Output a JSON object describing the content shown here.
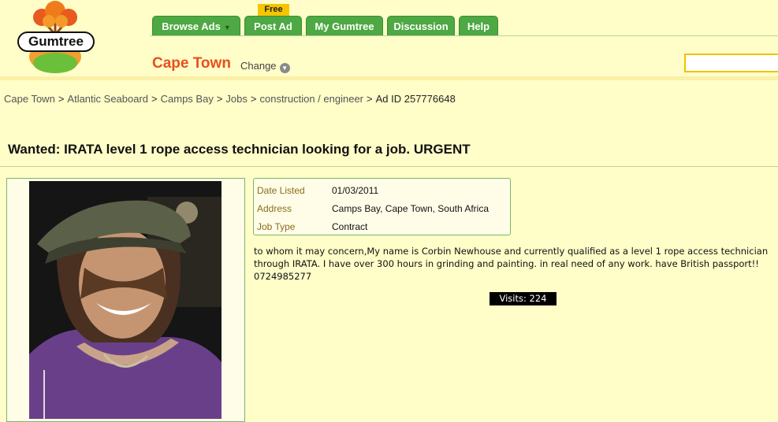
{
  "brand": {
    "name": "Gumtree"
  },
  "nav": {
    "tabs": [
      {
        "label": "Browse Ads"
      },
      {
        "label": "Post Ad"
      },
      {
        "label": "My Gumtree"
      },
      {
        "label": "Discussion"
      },
      {
        "label": "Help"
      }
    ],
    "free_badge": "Free",
    "accent": "#4ea843"
  },
  "location": {
    "city": "Cape Town",
    "change_label": "Change"
  },
  "breadcrumb": {
    "items": [
      "Cape Town",
      "Atlantic Seaboard",
      "Camps Bay",
      "Jobs",
      "construction / engineer"
    ],
    "ad_id": "Ad ID 257776648"
  },
  "ad": {
    "title": "Wanted: IRATA level 1 rope access technician looking for a job. URGENT",
    "details": [
      {
        "label": "Date Listed",
        "value": "01/03/2011"
      },
      {
        "label": "Address",
        "value": "Camps Bay, Cape Town, South Africa"
      },
      {
        "label": "Job Type",
        "value": "Contract"
      }
    ],
    "description": "to whom it may concern,My name is Corbin Newhouse and currently qualified as a level 1 rope access technician through IRATA. I have over 300 hours in grinding and painting. in real need of any work. have British passport!! 0724985277",
    "visits": "Visits: 224"
  }
}
